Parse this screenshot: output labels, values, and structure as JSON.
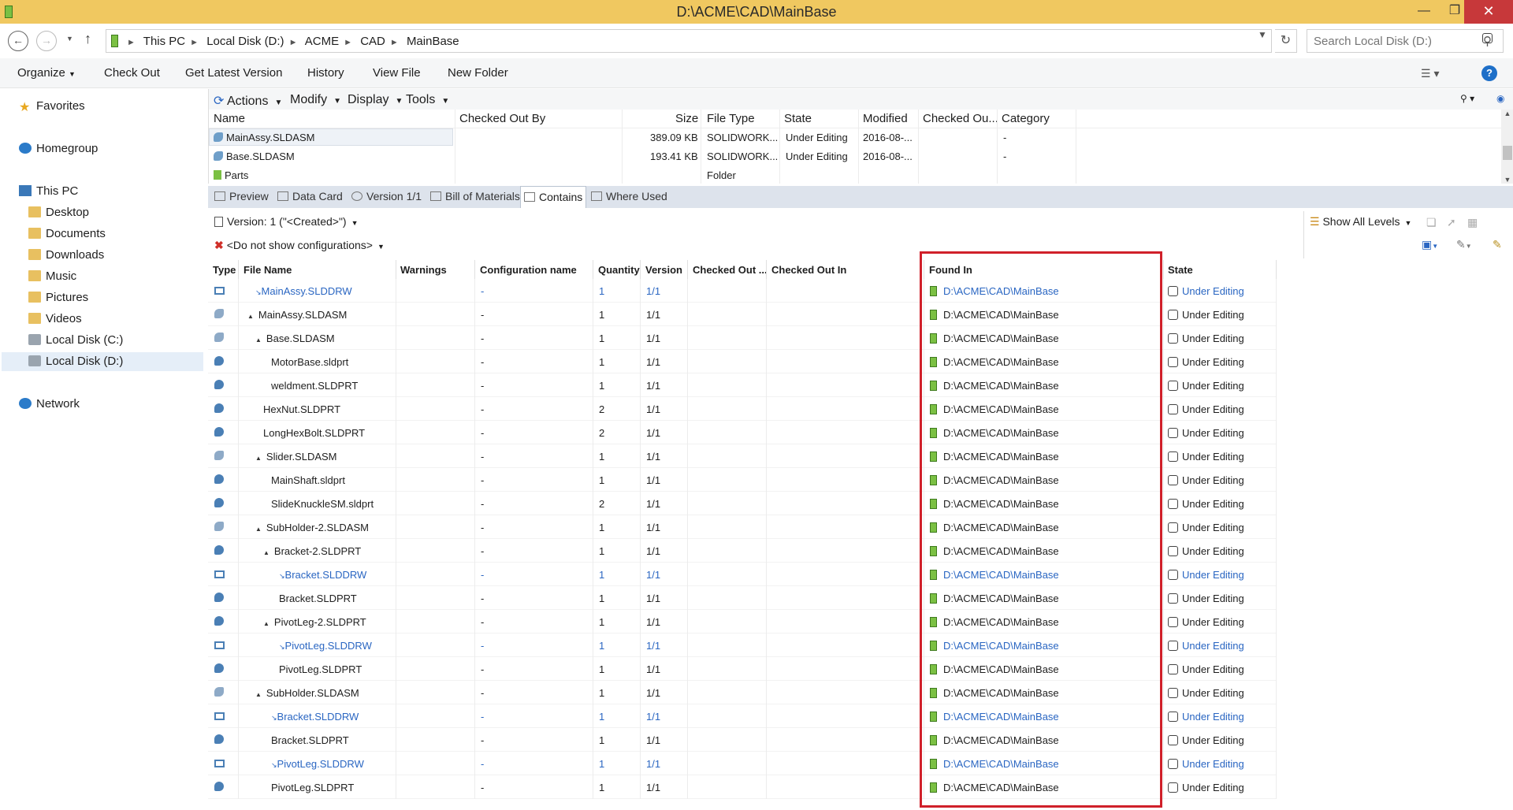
{
  "window": {
    "title": "D:\\ACME\\CAD\\MainBase"
  },
  "address": {
    "crumbs": [
      "This PC",
      "Local Disk (D:)",
      "ACME",
      "CAD",
      "MainBase"
    ],
    "search_placeholder": "Search Local Disk (D:)"
  },
  "commands": {
    "organize": "Organize",
    "check_out": "Check Out",
    "get_latest": "Get Latest Version",
    "history": "History",
    "view_file": "View File",
    "new_folder": "New Folder"
  },
  "nav": {
    "favorites": "Favorites",
    "homegroup": "Homegroup",
    "this_pc": "This PC",
    "desktop": "Desktop",
    "documents": "Documents",
    "downloads": "Downloads",
    "music": "Music",
    "pictures": "Pictures",
    "videos": "Videos",
    "local_c": "Local Disk (C:)",
    "local_d": "Local Disk (D:)",
    "network": "Network"
  },
  "vault": {
    "menus": {
      "actions": "Actions",
      "modify": "Modify",
      "display": "Display",
      "tools": "Tools"
    },
    "columns": {
      "name": "Name",
      "checked_out_by": "Checked Out By",
      "size": "Size",
      "file_type": "File Type",
      "state": "State",
      "modified": "Modified",
      "checked_out_in": "Checked Ou...",
      "category": "Category"
    },
    "rows": [
      {
        "name": "MainAssy.SLDASM",
        "size": "389.09 KB",
        "type": "SOLIDWORK...",
        "state": "Under Editing",
        "modified": "2016-08-...",
        "category": "-"
      },
      {
        "name": "Base.SLDASM",
        "size": "193.41 KB",
        "type": "SOLIDWORK...",
        "state": "Under Editing",
        "modified": "2016-08-...",
        "category": "-"
      },
      {
        "name": "Parts",
        "size": "",
        "type": "Folder",
        "state": "",
        "modified": "",
        "category": ""
      }
    ]
  },
  "tabs": {
    "preview": "Preview",
    "data_card": "Data Card",
    "version": "Version 1/1",
    "bom": "Bill of Materials",
    "contains": "Contains",
    "where_used": "Where Used"
  },
  "contains": {
    "version_select": "Version: 1 (\"<Created>\")",
    "config_select": "<Do not show configurations>",
    "show_levels": "Show All Levels",
    "columns": {
      "type": "Type",
      "file_name": "File Name",
      "warnings": "Warnings",
      "config": "Configuration name",
      "quantity": "Quantity",
      "version": "Version",
      "checked_out_by": "Checked Out ...",
      "checked_out_in": "Checked Out In",
      "found_in": "Found In",
      "state": "State"
    },
    "rows": [
      {
        "type": "drw",
        "indent": 1,
        "toggle": "",
        "name": "MainAssy.SLDDRW",
        "ref": true,
        "config": "-",
        "qty": "1",
        "ver": "1/1",
        "found": "D:\\ACME\\CAD\\MainBase",
        "state": "Under Editing",
        "blue": true
      },
      {
        "type": "asm",
        "indent": 0,
        "toggle": "▲",
        "name": "MainAssy.SLDASM",
        "ref": false,
        "config": "-",
        "qty": "1",
        "ver": "1/1",
        "found": "D:\\ACME\\CAD\\MainBase",
        "state": "Under Editing",
        "blue": false
      },
      {
        "type": "asm",
        "indent": 1,
        "toggle": "▲",
        "name": "Base.SLDASM",
        "ref": false,
        "config": "-",
        "qty": "1",
        "ver": "1/1",
        "found": "D:\\ACME\\CAD\\MainBase",
        "state": "Under Editing",
        "blue": false
      },
      {
        "type": "part",
        "indent": 3,
        "toggle": "",
        "name": "MotorBase.sldprt",
        "ref": false,
        "config": "-",
        "qty": "1",
        "ver": "1/1",
        "found": "D:\\ACME\\CAD\\MainBase",
        "state": "Under Editing",
        "blue": false
      },
      {
        "type": "part",
        "indent": 3,
        "toggle": "",
        "name": "weldment.SLDPRT",
        "ref": false,
        "config": "-",
        "qty": "1",
        "ver": "1/1",
        "found": "D:\\ACME\\CAD\\MainBase",
        "state": "Under Editing",
        "blue": false
      },
      {
        "type": "part",
        "indent": 2,
        "toggle": "",
        "name": "HexNut.SLDPRT",
        "ref": false,
        "config": "-",
        "qty": "2",
        "ver": "1/1",
        "found": "D:\\ACME\\CAD\\MainBase",
        "state": "Under Editing",
        "blue": false
      },
      {
        "type": "part",
        "indent": 2,
        "toggle": "",
        "name": "LongHexBolt.SLDPRT",
        "ref": false,
        "config": "-",
        "qty": "2",
        "ver": "1/1",
        "found": "D:\\ACME\\CAD\\MainBase",
        "state": "Under Editing",
        "blue": false
      },
      {
        "type": "asm",
        "indent": 1,
        "toggle": "▲",
        "name": "Slider.SLDASM",
        "ref": false,
        "config": "-",
        "qty": "1",
        "ver": "1/1",
        "found": "D:\\ACME\\CAD\\MainBase",
        "state": "Under Editing",
        "blue": false
      },
      {
        "type": "part",
        "indent": 3,
        "toggle": "",
        "name": "MainShaft.sldprt",
        "ref": false,
        "config": "-",
        "qty": "1",
        "ver": "1/1",
        "found": "D:\\ACME\\CAD\\MainBase",
        "state": "Under Editing",
        "blue": false
      },
      {
        "type": "part",
        "indent": 3,
        "toggle": "",
        "name": "SlideKnuckleSM.sldprt",
        "ref": false,
        "config": "-",
        "qty": "2",
        "ver": "1/1",
        "found": "D:\\ACME\\CAD\\MainBase",
        "state": "Under Editing",
        "blue": false
      },
      {
        "type": "asm",
        "indent": 1,
        "toggle": "▲",
        "name": "SubHolder-2.SLDASM",
        "ref": false,
        "config": "-",
        "qty": "1",
        "ver": "1/1",
        "found": "D:\\ACME\\CAD\\MainBase",
        "state": "Under Editing",
        "blue": false
      },
      {
        "type": "part",
        "indent": 2,
        "toggle": "▲",
        "name": "Bracket-2.SLDPRT",
        "ref": false,
        "config": "-",
        "qty": "1",
        "ver": "1/1",
        "found": "D:\\ACME\\CAD\\MainBase",
        "state": "Under Editing",
        "blue": false
      },
      {
        "type": "drw",
        "indent": 4,
        "toggle": "",
        "name": "Bracket.SLDDRW",
        "ref": true,
        "config": "-",
        "qty": "1",
        "ver": "1/1",
        "found": "D:\\ACME\\CAD\\MainBase",
        "state": "Under Editing",
        "blue": true
      },
      {
        "type": "part",
        "indent": 4,
        "toggle": "",
        "name": "Bracket.SLDPRT",
        "ref": false,
        "config": "-",
        "qty": "1",
        "ver": "1/1",
        "found": "D:\\ACME\\CAD\\MainBase",
        "state": "Under Editing",
        "blue": false
      },
      {
        "type": "part",
        "indent": 2,
        "toggle": "▲",
        "name": "PivotLeg-2.SLDPRT",
        "ref": false,
        "config": "-",
        "qty": "1",
        "ver": "1/1",
        "found": "D:\\ACME\\CAD\\MainBase",
        "state": "Under Editing",
        "blue": false
      },
      {
        "type": "drw",
        "indent": 4,
        "toggle": "",
        "name": "PivotLeg.SLDDRW",
        "ref": true,
        "config": "-",
        "qty": "1",
        "ver": "1/1",
        "found": "D:\\ACME\\CAD\\MainBase",
        "state": "Under Editing",
        "blue": true
      },
      {
        "type": "part",
        "indent": 4,
        "toggle": "",
        "name": "PivotLeg.SLDPRT",
        "ref": false,
        "config": "-",
        "qty": "1",
        "ver": "1/1",
        "found": "D:\\ACME\\CAD\\MainBase",
        "state": "Under Editing",
        "blue": false
      },
      {
        "type": "asm",
        "indent": 1,
        "toggle": "▲",
        "name": "SubHolder.SLDASM",
        "ref": false,
        "config": "-",
        "qty": "1",
        "ver": "1/1",
        "found": "D:\\ACME\\CAD\\MainBase",
        "state": "Under Editing",
        "blue": false
      },
      {
        "type": "drw",
        "indent": 3,
        "toggle": "",
        "name": "Bracket.SLDDRW",
        "ref": true,
        "config": "-",
        "qty": "1",
        "ver": "1/1",
        "found": "D:\\ACME\\CAD\\MainBase",
        "state": "Under Editing",
        "blue": true
      },
      {
        "type": "part",
        "indent": 3,
        "toggle": "",
        "name": "Bracket.SLDPRT",
        "ref": false,
        "config": "-",
        "qty": "1",
        "ver": "1/1",
        "found": "D:\\ACME\\CAD\\MainBase",
        "state": "Under Editing",
        "blue": false
      },
      {
        "type": "drw",
        "indent": 3,
        "toggle": "",
        "name": "PivotLeg.SLDDRW",
        "ref": true,
        "config": "-",
        "qty": "1",
        "ver": "1/1",
        "found": "D:\\ACME\\CAD\\MainBase",
        "state": "Under Editing",
        "blue": true
      },
      {
        "type": "part",
        "indent": 3,
        "toggle": "",
        "name": "PivotLeg.SLDPRT",
        "ref": false,
        "config": "-",
        "qty": "1",
        "ver": "1/1",
        "found": "D:\\ACME\\CAD\\MainBase",
        "state": "Under Editing",
        "blue": false
      }
    ]
  },
  "colors": {
    "titlebar": "#f0c860",
    "close": "#c7383a",
    "link": "#2a66c2",
    "highlight": "#d0202a",
    "vault_green": "#7bc043"
  }
}
